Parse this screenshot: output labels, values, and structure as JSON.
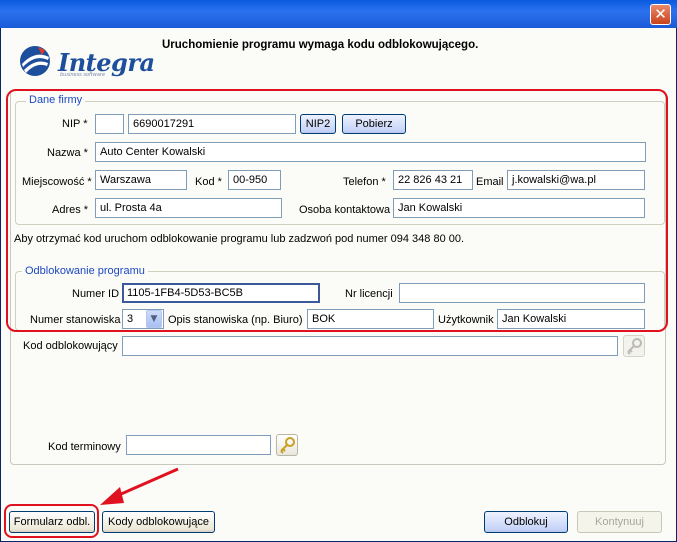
{
  "window": {
    "close_glyph": "✕"
  },
  "logo": {
    "name": "Integra",
    "subtitle": "business software",
    "colors": {
      "mark": "#1e4f9c",
      "accent": "#e03a24"
    }
  },
  "heading": "Uruchomienie programu wymaga kodu odblokowującego.",
  "company": {
    "legend": "Dane firmy",
    "nip_label": "NIP *",
    "nip_prefix": "",
    "nip_value": "6690017291",
    "nip2_button": "NIP2",
    "fetch_button": "Pobierz",
    "name_label": "Nazwa *",
    "name_value": "Auto Center Kowalski",
    "city_label": "Miejscowość *",
    "city_value": "Warszawa",
    "zip_label": "Kod *",
    "zip_value": "00-950",
    "phone_label": "Telefon *",
    "phone_value": "22 826 43 21",
    "email_label": "Email",
    "email_value": "j.kowalski@wa.pl",
    "address_label": "Adres *",
    "address_value": "ul. Prosta 4a",
    "contact_label": "Osoba kontaktowa",
    "contact_value": "Jan Kowalski"
  },
  "info_text": "Aby otrzymać kod uruchom odblokowanie programu lub zadzwoń pod numer 094 348 80 00.",
  "unlock": {
    "legend": "Odblokowanie programu",
    "id_label": "Numer ID",
    "id_value": "1105-1FB4-5D53-BC5B",
    "license_label": "Nr licencji",
    "license_value": "",
    "station_label": "Numer stanowiska",
    "station_value": "3",
    "station_desc_label": "Opis stanowiska (np. Biuro)",
    "station_desc_value": "BOK",
    "user_label": "Użytkownik",
    "user_value": "Jan Kowalski"
  },
  "unlock_code": {
    "label": "Kod odblokowujący",
    "value": ""
  },
  "term_code": {
    "label": "Kod terminowy",
    "value": ""
  },
  "footer": {
    "form_button": "Formularz odbl.",
    "codes_button": "Kody odblokowujące",
    "unlock_button": "Odblokuj",
    "continue_button": "Kontynuuj"
  },
  "annotation_color": "#e0121f"
}
